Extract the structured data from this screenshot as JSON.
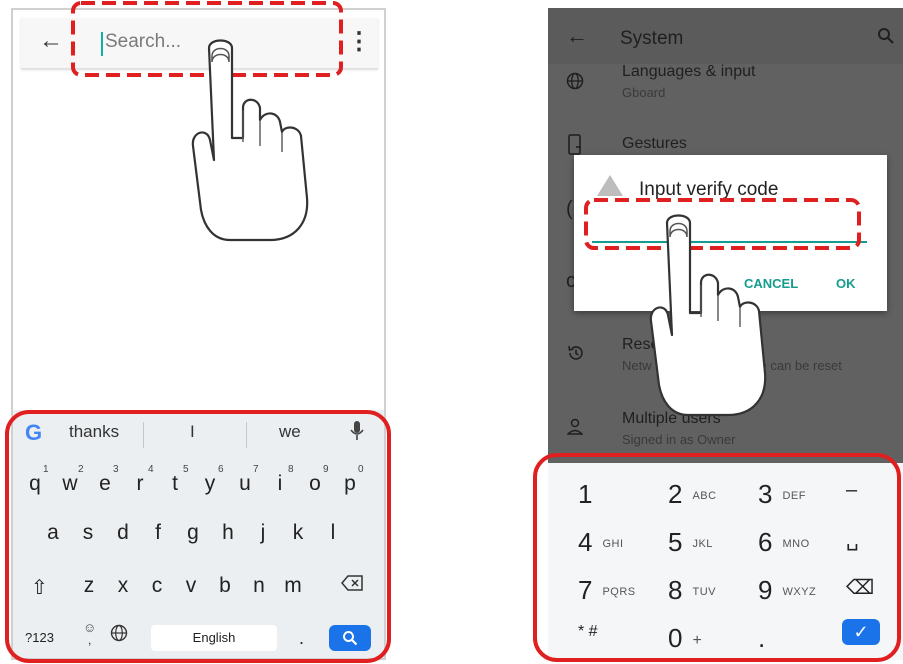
{
  "left": {
    "search": {
      "placeholder": "Search..."
    },
    "suggestions": [
      "thanks",
      "I",
      "we"
    ],
    "rows": [
      [
        "q",
        "w",
        "e",
        "r",
        "t",
        "y",
        "u",
        "i",
        "o",
        "p"
      ],
      [
        "a",
        "s",
        "d",
        "f",
        "g",
        "h",
        "j",
        "k",
        "l"
      ],
      [
        "z",
        "x",
        "c",
        "v",
        "b",
        "n",
        "m"
      ]
    ],
    "number_hints": [
      "1",
      "2",
      "3",
      "4",
      "5",
      "6",
      "7",
      "8",
      "9",
      "0"
    ],
    "bottom": {
      "sym_label": "?123",
      "space_label": "English",
      "period": "."
    }
  },
  "right": {
    "title": "System",
    "items": [
      {
        "title": "Languages & input",
        "subtitle": "Gboard"
      },
      {
        "title": "Gestures"
      },
      {
        "title": "Rese",
        "subtitle_start": "Netw",
        "subtitle_end": "ce can be reset"
      },
      {
        "title": "Multiple users",
        "subtitle": "Signed in as Owner"
      }
    ],
    "dialog": {
      "title": "Input verify code",
      "cancel": "CANCEL",
      "ok": "OK"
    },
    "numpad": [
      [
        {
          "d": "1",
          "l": ""
        },
        {
          "d": "2",
          "l": "ABC"
        },
        {
          "d": "3",
          "l": "DEF"
        },
        {
          "d": "–",
          "l": ""
        }
      ],
      [
        {
          "d": "4",
          "l": "GHI"
        },
        {
          "d": "5",
          "l": "JKL"
        },
        {
          "d": "6",
          "l": "MNO"
        },
        {
          "d": "␣",
          "l": ""
        }
      ],
      [
        {
          "d": "7",
          "l": "PQRS"
        },
        {
          "d": "8",
          "l": "TUV"
        },
        {
          "d": "9",
          "l": "WXYZ"
        },
        {
          "d": "⌫",
          "l": ""
        }
      ],
      [
        {
          "d": "* #",
          "l": ""
        },
        {
          "d": "0",
          "l": "+"
        },
        {
          "d": ".",
          "l": ""
        },
        {
          "d": "✓",
          "l": ""
        }
      ]
    ]
  },
  "colors": {
    "highlight": "#e02020",
    "accent_teal": "#169c8f",
    "enter_blue": "#1a73e8"
  }
}
